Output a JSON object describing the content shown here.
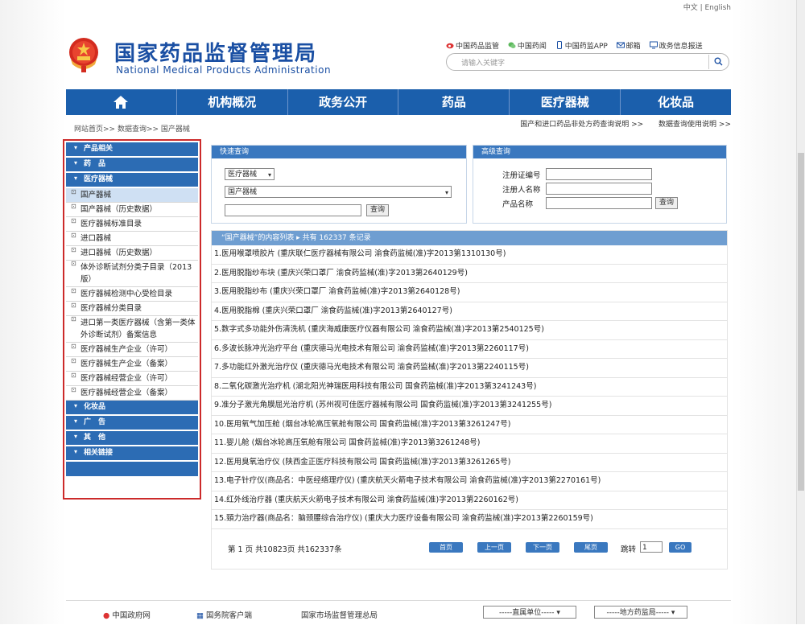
{
  "lang": {
    "cn": "中文",
    "sep": "|",
    "en": "English"
  },
  "header": {
    "title_cn": "国家药品监督管理局",
    "title_en": "National Medical Products Administration",
    "links": [
      "中国药品监管",
      "中国药闻",
      "中国药监APP",
      "邮箱",
      "政务信息报送"
    ],
    "search_placeholder": "请输入关键字"
  },
  "nav": [
    "机构概况",
    "政务公开",
    "药品",
    "医疗器械",
    "化妆品"
  ],
  "breadcrumb": "网站首页>> 数据查询>> 国产器械",
  "right_links": [
    "国产和进口药品非处方药查询说明 >>",
    "数据查询使用说明 >>"
  ],
  "sidebar": {
    "categories": [
      "产品相关",
      "药　品",
      "医疗器械",
      "化妆品",
      "广　告",
      "其　他",
      "相关链接"
    ],
    "device_items": [
      "国产器械",
      "国产器械（历史数据）",
      "医疗器械标准目录",
      "进口器械",
      "进口器械（历史数据）",
      "体外诊断试剂分类子目录（2013版）",
      "医疗器械检测中心受检目录",
      "医疗器械分类目录",
      "进口第一类医疗器械（含第一类体外诊断试剂）备案信息",
      "医疗器械生产企业（许可）",
      "医疗器械生产企业（备案）",
      "医疗器械经营企业（许可）",
      "医疗器械经营企业（备案）"
    ]
  },
  "search_panel": {
    "title": "快速查询",
    "select1": "医疗器械",
    "select2": "国产器械",
    "button": "查询"
  },
  "advanced_panel": {
    "title": "高级查询",
    "labels": [
      "注册证编号",
      "注册人名称",
      "产品名称"
    ],
    "button": "查询"
  },
  "results": {
    "header": "“国产器械”的内容列表 ▸ 共有 162337 条记录",
    "rows": [
      "1.医用喉罩喷胶片 (重庆联仁医疗器械有限公司 渝食药监械(准)字2013第1310130号)",
      "2.医用脱脂纱布块 (重庆兴荣口罩厂 渝食药监械(准)字2013第2640129号)",
      "3.医用脱脂纱布 (重庆兴荣口罩厂 渝食药监械(准)字2013第2640128号)",
      "4.医用脱脂棉 (重庆兴荣口罩厂 渝食药监械(准)字2013第2640127号)",
      "5.数字式多功能外伤清洗机 (重庆海威康医疗仪器有限公司 渝食药监械(准)字2013第2540125号)",
      "6.多波长脉冲光治疗平台 (重庆德马光电技术有限公司 渝食药监械(准)字2013第2260117号)",
      "7.多功能红外激光治疗仪 (重庆德马光电技术有限公司 渝食药监械(准)字2013第2240115号)",
      "8.二氧化碳激光治疗机 (湖北阳光神瑞医用科技有限公司 国食药监械(准)字2013第3241243号)",
      "9.准分子激光角膜屈光治疗机 (苏州视可佳医疗器械有限公司 国食药监械(准)字2013第3241255号)",
      "10.医用氧气加压舱 (烟台冰轮高压氧舱有限公司 国食药监械(准)字2013第3261247号)",
      "11.婴儿舱 (烟台冰轮高压氧舱有限公司 国食药监械(准)字2013第3261248号)",
      "12.医用臭氧治疗仪 (陕西金正医疗科技有限公司 国食药监械(准)字2013第3261265号)",
      "13.电子针疗仪(商品名：中医经络理疗仪) (重庆航天火箭电子技术有限公司 渝食药监械(准)字2013第2270161号)",
      "14.红外线治疗器 (重庆航天火箭电子技术有限公司 渝食药监械(准)字2013第2260162号)",
      "15.頸力治疗器(商品名：脑颈腰综合治疗仪) (重庆大力医疗设备有限公司 渝食药监械(准)字2013第2260159号)"
    ]
  },
  "pager": {
    "info": "第 1 页 共10823页 共162337条",
    "buttons": [
      "首页",
      "上一页",
      "下一页",
      "尾页"
    ],
    "goto_label": "跳转",
    "goto_value": "1",
    "go": "GO"
  },
  "footer": {
    "links": [
      "中国政府网",
      "国务院客户端",
      "国家市场监督管理总局"
    ],
    "select1": "-----直属单位-----",
    "select2": "-----地方药监局-----"
  },
  "colors": {
    "brand": "#1b5fac",
    "sidebar_border": "#cc2a2a",
    "accent_blue": "#3a78bf"
  }
}
